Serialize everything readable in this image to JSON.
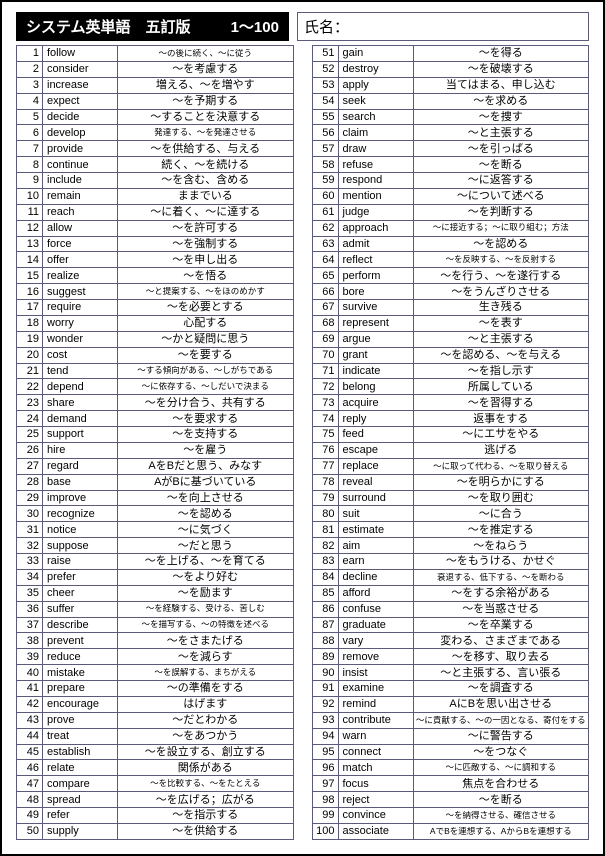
{
  "header": {
    "title": "システム英単語　五訂版",
    "range": "1～100",
    "name_label": "氏名："
  },
  "left": [
    {
      "n": 1,
      "w": "follow",
      "m": "～の後に続く、～に従う",
      "small": true
    },
    {
      "n": 2,
      "w": "consider",
      "m": "～を考慮する"
    },
    {
      "n": 3,
      "w": "increase",
      "m": "増える、～を増やす"
    },
    {
      "n": 4,
      "w": "expect",
      "m": "～を予期する"
    },
    {
      "n": 5,
      "w": "decide",
      "m": "～することを決意する"
    },
    {
      "n": 6,
      "w": "develop",
      "m": "発達する、～を発達させる",
      "small": true
    },
    {
      "n": 7,
      "w": "provide",
      "m": "～を供給する、与える"
    },
    {
      "n": 8,
      "w": "continue",
      "m": "続く、～を続ける"
    },
    {
      "n": 9,
      "w": "include",
      "m": "～を含む、含める"
    },
    {
      "n": 10,
      "w": "remain",
      "m": "ままでいる"
    },
    {
      "n": 11,
      "w": "reach",
      "m": "～に着く、～に達する"
    },
    {
      "n": 12,
      "w": "allow",
      "m": "～を許可する"
    },
    {
      "n": 13,
      "w": "force",
      "m": "～を強制する"
    },
    {
      "n": 14,
      "w": "offer",
      "m": "～を申し出る"
    },
    {
      "n": 15,
      "w": "realize",
      "m": "～を悟る"
    },
    {
      "n": 16,
      "w": "suggest",
      "m": "～と提案する、～をほのめかす",
      "small": true
    },
    {
      "n": 17,
      "w": "require",
      "m": "～を必要とする"
    },
    {
      "n": 18,
      "w": "worry",
      "m": "心配する"
    },
    {
      "n": 19,
      "w": "wonder",
      "m": "～かと疑問に思う"
    },
    {
      "n": 20,
      "w": "cost",
      "m": "～を要する"
    },
    {
      "n": 21,
      "w": "tend",
      "m": "～する傾向がある、～しがちである",
      "small": true
    },
    {
      "n": 22,
      "w": "depend",
      "m": "～に依存する、～しだいで決まる",
      "small": true
    },
    {
      "n": 23,
      "w": "share",
      "m": "～を分け合う、共有する"
    },
    {
      "n": 24,
      "w": "demand",
      "m": "～を要求する"
    },
    {
      "n": 25,
      "w": "support",
      "m": "～を支持する"
    },
    {
      "n": 26,
      "w": "hire",
      "m": "～を雇う"
    },
    {
      "n": 27,
      "w": "regard",
      "m": "AをBだと思う、みなす"
    },
    {
      "n": 28,
      "w": "base",
      "m": "AがBに基づいている"
    },
    {
      "n": 29,
      "w": "improve",
      "m": "～を向上させる"
    },
    {
      "n": 30,
      "w": "recognize",
      "m": "～を認める"
    },
    {
      "n": 31,
      "w": "notice",
      "m": "～に気づく"
    },
    {
      "n": 32,
      "w": "suppose",
      "m": "～だと思う"
    },
    {
      "n": 33,
      "w": "raise",
      "m": "～を上げる、～を育てる"
    },
    {
      "n": 34,
      "w": "prefer",
      "m": "～をより好む"
    },
    {
      "n": 35,
      "w": "cheer",
      "m": "～を励ます"
    },
    {
      "n": 36,
      "w": "suffer",
      "m": "～を経験する、受ける、苦しむ",
      "small": true
    },
    {
      "n": 37,
      "w": "describe",
      "m": "～を描写する、～の特徴を述べる",
      "small": true
    },
    {
      "n": 38,
      "w": "prevent",
      "m": "～をさまたげる"
    },
    {
      "n": 39,
      "w": "reduce",
      "m": "～を減らす"
    },
    {
      "n": 40,
      "w": "mistake",
      "m": "～を誤解する、まちがえる",
      "small": true
    },
    {
      "n": 41,
      "w": "prepare",
      "m": "～の準備をする"
    },
    {
      "n": 42,
      "w": "encourage",
      "m": "はげます"
    },
    {
      "n": 43,
      "w": "prove",
      "m": "～だとわかる"
    },
    {
      "n": 44,
      "w": "treat",
      "m": "～をあつかう"
    },
    {
      "n": 45,
      "w": "establish",
      "m": "～を設立する、創立する"
    },
    {
      "n": 46,
      "w": "relate",
      "m": "関係がある"
    },
    {
      "n": 47,
      "w": "compare",
      "m": "～を比較する、～をたとえる",
      "small": true
    },
    {
      "n": 48,
      "w": "spread",
      "m": "～を広げる；広がる"
    },
    {
      "n": 49,
      "w": "refer",
      "m": "～を指示する"
    },
    {
      "n": 50,
      "w": "supply",
      "m": "～を供給する"
    }
  ],
  "right": [
    {
      "n": 51,
      "w": "gain",
      "m": "～を得る"
    },
    {
      "n": 52,
      "w": "destroy",
      "m": "～を破壊する"
    },
    {
      "n": 53,
      "w": "apply",
      "m": "当てはまる、申し込む"
    },
    {
      "n": 54,
      "w": "seek",
      "m": "～を求める"
    },
    {
      "n": 55,
      "w": "search",
      "m": "～を捜す"
    },
    {
      "n": 56,
      "w": "claim",
      "m": "～と主張する"
    },
    {
      "n": 57,
      "w": "draw",
      "m": "～を引っぱる"
    },
    {
      "n": 58,
      "w": "refuse",
      "m": "～を断る"
    },
    {
      "n": 59,
      "w": "respond",
      "m": "～に返答する"
    },
    {
      "n": 60,
      "w": "mention",
      "m": "～について述べる"
    },
    {
      "n": 61,
      "w": "judge",
      "m": "～を判断する"
    },
    {
      "n": 62,
      "w": "approach",
      "m": "～に接近する；～に取り組む；方法",
      "small": true
    },
    {
      "n": 63,
      "w": "admit",
      "m": "～を認める"
    },
    {
      "n": 64,
      "w": "reflect",
      "m": "～を反映する、～を反射する",
      "small": true
    },
    {
      "n": 65,
      "w": "perform",
      "m": "～を行う、～を遂行する"
    },
    {
      "n": 66,
      "w": "bore",
      "m": "～をうんざりさせる"
    },
    {
      "n": 67,
      "w": "survive",
      "m": "生き残る"
    },
    {
      "n": 68,
      "w": "represent",
      "m": "～を表す"
    },
    {
      "n": 69,
      "w": "argue",
      "m": "～と主張する"
    },
    {
      "n": 70,
      "w": "grant",
      "m": "～を認める、～を与える"
    },
    {
      "n": 71,
      "w": "indicate",
      "m": "～を指し示す"
    },
    {
      "n": 72,
      "w": "belong",
      "m": "所属している"
    },
    {
      "n": 73,
      "w": "acquire",
      "m": "～を習得する"
    },
    {
      "n": 74,
      "w": "reply",
      "m": "返事をする"
    },
    {
      "n": 75,
      "w": "feed",
      "m": "～にエサをやる"
    },
    {
      "n": 76,
      "w": "escape",
      "m": "逃げる"
    },
    {
      "n": 77,
      "w": "replace",
      "m": "～に取って代わる、～を取り替える",
      "small": true
    },
    {
      "n": 78,
      "w": "reveal",
      "m": "～を明らかにする"
    },
    {
      "n": 79,
      "w": "surround",
      "m": "～を取り囲む"
    },
    {
      "n": 80,
      "w": "suit",
      "m": "～に合う"
    },
    {
      "n": 81,
      "w": "estimate",
      "m": "～を推定する"
    },
    {
      "n": 82,
      "w": "aim",
      "m": "～をねらう"
    },
    {
      "n": 83,
      "w": "earn",
      "m": "～をもうける、かせぐ"
    },
    {
      "n": 84,
      "w": "decline",
      "m": "衰退する、低下する、～を断わる",
      "small": true
    },
    {
      "n": 85,
      "w": "afford",
      "m": "～をする余裕がある"
    },
    {
      "n": 86,
      "w": "confuse",
      "m": "～を当惑させる"
    },
    {
      "n": 87,
      "w": "graduate",
      "m": "～を卒業する"
    },
    {
      "n": 88,
      "w": "vary",
      "m": "変わる、さまざまである"
    },
    {
      "n": 89,
      "w": "remove",
      "m": "～を移す、取り去る"
    },
    {
      "n": 90,
      "w": "insist",
      "m": "～と主張する、言い張る"
    },
    {
      "n": 91,
      "w": "examine",
      "m": "～を調査する"
    },
    {
      "n": 92,
      "w": "remind",
      "m": "AにBを思い出させる"
    },
    {
      "n": 93,
      "w": "contribute",
      "m": "～に貢献する、～の一因となる、寄付をする",
      "small": true
    },
    {
      "n": 94,
      "w": "warn",
      "m": "～に警告する"
    },
    {
      "n": 95,
      "w": "connect",
      "m": "～をつなぐ"
    },
    {
      "n": 96,
      "w": "match",
      "m": "～に匹敵する、～に調和する",
      "small": true
    },
    {
      "n": 97,
      "w": "focus",
      "m": "焦点を合わせる"
    },
    {
      "n": 98,
      "w": "reject",
      "m": "～を断る"
    },
    {
      "n": 99,
      "w": "convince",
      "m": "～を納得させる、確信させる",
      "small": true
    },
    {
      "n": 100,
      "w": "associate",
      "m": "AでBを連想する、AからBを連想する",
      "small": true
    }
  ]
}
